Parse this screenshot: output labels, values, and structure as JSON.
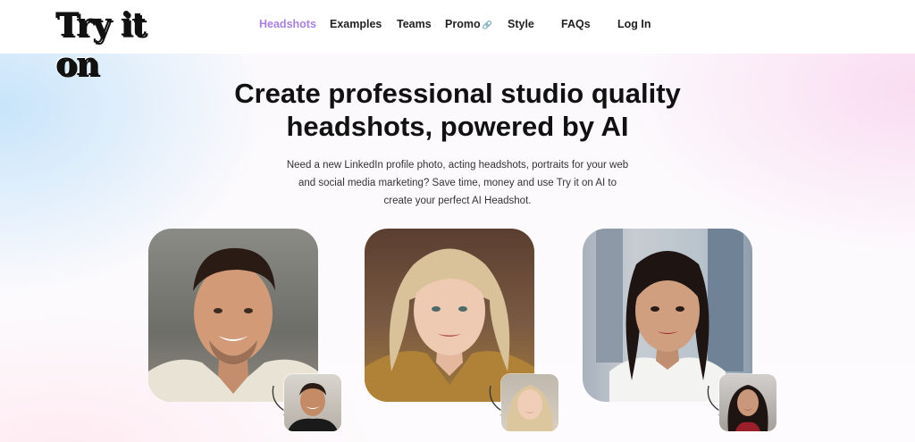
{
  "logo": {
    "text": "Try it on"
  },
  "nav": {
    "items": [
      {
        "label": "Headshots",
        "active": true
      },
      {
        "label": "Examples"
      },
      {
        "label": "Teams"
      },
      {
        "label": "Promo",
        "icon": "link-icon"
      },
      {
        "label": "Style"
      },
      {
        "label": "FAQs"
      },
      {
        "label": "Log In"
      }
    ],
    "active_color": "#a97fe3"
  },
  "hero": {
    "title_line1": "Create professional studio quality",
    "title_line2": "headshots, powered by AI",
    "description_line1": "Need a new LinkedIn profile photo, acting headshots, portraits for your web",
    "description_line2": "and social media marketing? Save time, money and use Try it on AI to",
    "description_line3": "create your perfect AI Headshot."
  },
  "examples": [
    {
      "name": "man-headshot",
      "thumb": "man-selfie"
    },
    {
      "name": "woman-blonde-headshot",
      "thumb": "woman-blonde-selfie"
    },
    {
      "name": "woman-dark-hair-headshot",
      "thumb": "woman-dark-hair-selfie"
    }
  ]
}
